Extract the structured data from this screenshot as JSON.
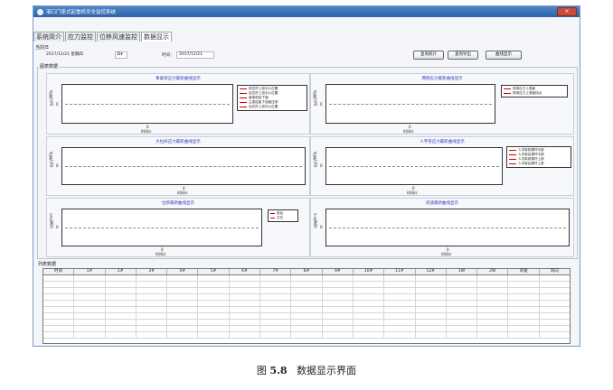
{
  "window": {
    "title": "港口门座式起重机安全监控系统",
    "close_label": "×"
  },
  "tabs": [
    {
      "label": "系统简介",
      "active": false
    },
    {
      "label": "应力监控",
      "active": false
    },
    {
      "label": "位移风速监控",
      "active": false
    },
    {
      "label": "数据显示",
      "active": true
    }
  ],
  "toolbar": {
    "time_group": "当前日",
    "date_value": "2017/12/21 星期四",
    "dropdown_value": "日▾",
    "time_label": "时间：",
    "time_value": "2017/12/21",
    "buttons": [
      "查询统计",
      "查询导出",
      "曲线显示"
    ]
  },
  "chart_group_label": "图表数据",
  "panels": [
    {
      "title": "象鼻梁应力最新曲线显示",
      "ylabel": "应力/MPa",
      "xlabel": "时间/s",
      "zero": "0",
      "legend": [
        "前拉杆上铰中心位置",
        "后拉杆上铰中心位置",
        "臂架前铰下端",
        "主梁连接下铰面压测",
        "后拉杆上铰中心位置"
      ]
    },
    {
      "title": "两侧应力最新曲线显示",
      "ylabel": "应力/MPa",
      "xlabel": "时间/s",
      "zero": "0",
      "legend": [
        "现场应力上表面",
        "现场应力上表面拐点"
      ]
    },
    {
      "title": "大拉杆应力最新曲线显示",
      "ylabel": "应力/MPa",
      "xlabel": "时间/s",
      "zero": "0",
      "legend": []
    },
    {
      "title": "人字架应力最新曲线显示",
      "ylabel": "应力/MPa",
      "xlabel": "时间/s",
      "zero": "0",
      "legend": [
        "人字架前撑杆中部",
        "人字架后撑杆中部",
        "人字架前撑杆上部",
        "人字架后撑杆上部"
      ]
    },
    {
      "title": "位移最新曲线显示",
      "ylabel": "位移/mm",
      "xlabel": "时间/s",
      "zero": "0",
      "legend": [
        "前后",
        "左右"
      ]
    },
    {
      "title": "风速最新曲线显示",
      "ylabel": "风速/m·s",
      "xlabel": "时间/s",
      "zero": "0",
      "legend": []
    }
  ],
  "table": {
    "label": "列表数据",
    "columns": [
      "时间",
      "1#",
      "2#",
      "3#",
      "4#",
      "5#",
      "6#",
      "7#",
      "8#",
      "9#",
      "10#",
      "11#",
      "12#",
      "1W",
      "2W",
      "风速",
      "风向"
    ],
    "row_count": 10
  },
  "caption": {
    "prefix": "图",
    "number": "5.8",
    "text": "数据显示界面"
  },
  "colors": {
    "legend_line": "#cc0000",
    "panel_title": "#2b3fbf",
    "titlebar": "#2d62a8"
  }
}
